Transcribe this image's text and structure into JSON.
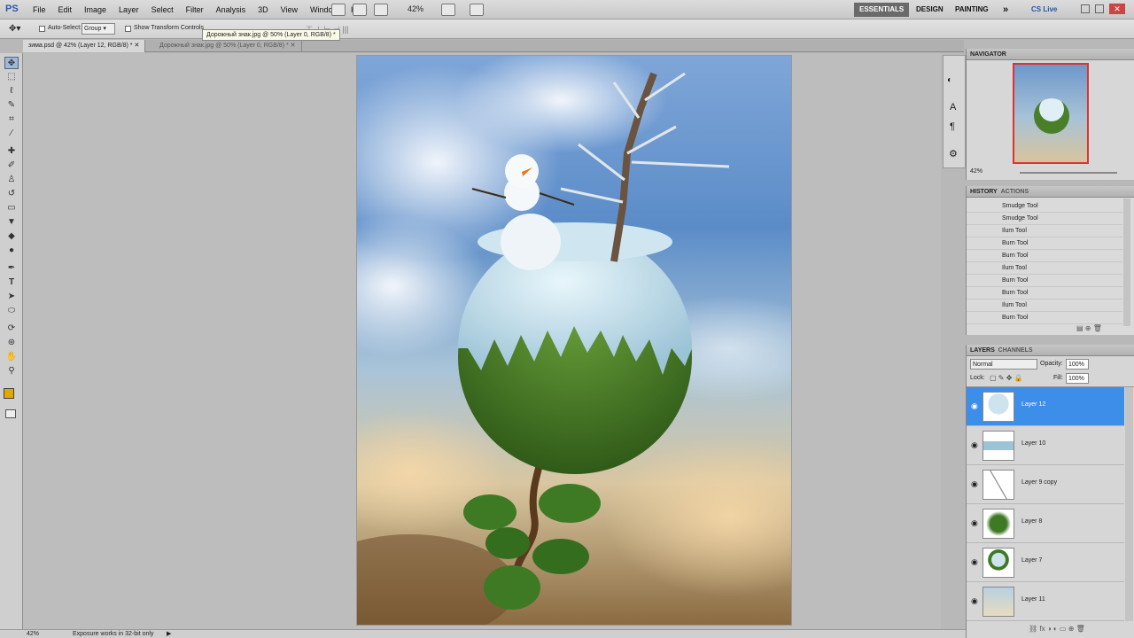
{
  "app": {
    "logo": "PS",
    "zoom": "42%"
  },
  "menu": [
    "File",
    "Edit",
    "Image",
    "Layer",
    "Select",
    "Filter",
    "Analysis",
    "3D",
    "View",
    "Window",
    "Help"
  ],
  "workspace": {
    "essentials": "ESSENTIALS",
    "design": "DESIGN",
    "painting": "PAINTING",
    "more": "»",
    "cslive": "CS Live"
  },
  "options": {
    "auto_select": "Auto-Select:",
    "group": "Group",
    "transform": "Show Transform Controls"
  },
  "tooltip": "Дорожный знак.jpg @ 50% (Layer 0, RGB/8) *",
  "tabs": [
    "зима.psd @ 42% (Layer 12, RGB/8) *",
    "Дорожный знак.jpg @ 50% (Layer 0, RGB/8) *"
  ],
  "navigator": {
    "title": "NAVIGATOR",
    "zoom": "42%"
  },
  "history": {
    "tabs": [
      "HISTORY",
      "ACTIONS"
    ],
    "items": [
      "Smudge Tool",
      "Smudge Tool",
      "Ilum Tool",
      "Burn Tool",
      "Burn Tool",
      "Ilum Tool",
      "Burn Tool",
      "Burn Tool",
      "Ilum Tool",
      "Burn Tool"
    ]
  },
  "layers": {
    "tabs": [
      "LAYERS",
      "CHANNELS"
    ],
    "blend": "Normal",
    "opacity_label": "Opacity:",
    "opacity": "100%",
    "lock_label": "Lock:",
    "fill_label": "Fill:",
    "fill": "100%",
    "items": [
      "Layer 12",
      "Layer 10",
      "Layer 9 copy",
      "Layer 8",
      "Layer 7",
      "Layer 11"
    ],
    "selected_index": 0
  },
  "status": {
    "zoom": "42%",
    "info": "Exposure works in 32-bit only"
  },
  "colors": {
    "selection": "#3d8ee8",
    "foreground": "#e0a800",
    "background": "#111111"
  }
}
